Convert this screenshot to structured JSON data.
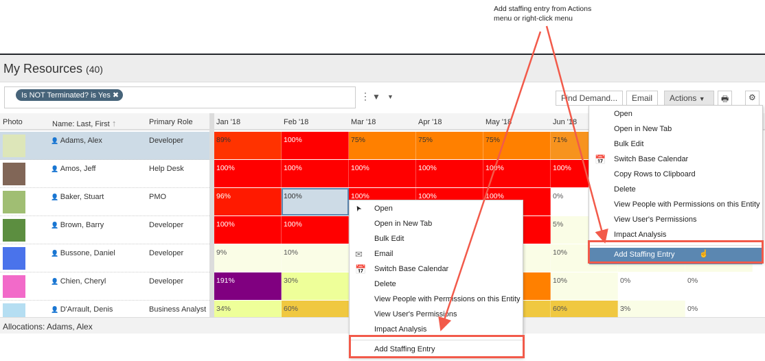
{
  "annotation": {
    "line1": "Add staffing entry from Actions",
    "line2": "menu or right-click menu"
  },
  "title": "My Resources",
  "count": "(40)",
  "filter": {
    "chip": "Is NOT Terminated? is Yes"
  },
  "toolbar": {
    "find_demand": "Find Demand...",
    "email": "Email",
    "actions": "Actions"
  },
  "columns": {
    "photo": "Photo",
    "name": "Name: Last, First",
    "role": "Primary Role",
    "months": [
      "Jan '18",
      "Feb '18",
      "Mar '18",
      "Apr '18",
      "May '18",
      "Jun '18"
    ]
  },
  "colors": {
    "red": "#ff0000",
    "orange": "#ff8000",
    "purple": "#800080",
    "selected": "#cddbe6",
    "accent": "#5b87b1",
    "highlight": "#f25a4a"
  },
  "rows": [
    {
      "name": "Adams, Alex",
      "role": "Developer",
      "avatar": "#dfe8b0",
      "selected": true,
      "cells": [
        [
          "89%",
          "#ff3300",
          "#333"
        ],
        [
          "100%",
          "#ff0000",
          "#fff"
        ],
        [
          "75%",
          "#ff8000",
          "#333"
        ],
        [
          "75%",
          "#ff8000",
          "#333"
        ],
        [
          "75%",
          "#ff8000",
          "#333"
        ],
        [
          "71%",
          "#f7931e",
          "#333"
        ],
        [
          "",
          "#f7931e",
          "#333"
        ],
        [
          "",
          "#f7931e",
          "#333"
        ]
      ]
    },
    {
      "name": "Amos, Jeff",
      "role": "Help Desk",
      "avatar": "#6b4b3a",
      "cells": [
        [
          "100%",
          "#ff0000",
          "#fff"
        ],
        [
          "100%",
          "#ff0000",
          "#fff"
        ],
        [
          "100%",
          "#ff0000",
          "#fff"
        ],
        [
          "100%",
          "#ff0000",
          "#fff"
        ],
        [
          "100%",
          "#ff0000",
          "#fff"
        ],
        [
          "100%",
          "#ff0000",
          "#fff"
        ],
        [
          "",
          "#ff0000",
          "#fff"
        ],
        [
          "",
          "#ff0000",
          "#fff"
        ]
      ]
    },
    {
      "name": "Baker, Stuart",
      "role": "PMO",
      "avatar": "#8fb35a",
      "cells": [
        [
          "96%",
          "#ff1a00",
          "#fff"
        ],
        [
          "100%",
          "#cddbe6",
          "#333"
        ],
        [
          "100%",
          "#ff0000",
          "#fff"
        ],
        [
          "100%",
          "#ff0000",
          "#fff"
        ],
        [
          "100%",
          "#ff0000",
          "#fff"
        ],
        [
          "0%",
          "#ffffff",
          "#555"
        ],
        [
          "",
          "#ffffff",
          "#555"
        ],
        [
          "",
          "#ffffff",
          "#555"
        ]
      ]
    },
    {
      "name": "Brown, Barry",
      "role": "Developer",
      "avatar": "#3f7a1e",
      "cells": [
        [
          "100%",
          "#ff0000",
          "#fff"
        ],
        [
          "100%",
          "#ff0000",
          "#fff"
        ],
        [
          "",
          "#ff0000",
          "#fff"
        ],
        [
          "",
          "#ff0000",
          "#fff"
        ],
        [
          "",
          "#ff0000",
          "#fff"
        ],
        [
          "5%",
          "#fafde6",
          "#555"
        ],
        [
          "",
          "#fafde6",
          "#555"
        ],
        [
          "",
          "#fafde6",
          "#555"
        ]
      ]
    },
    {
      "name": "Bussone, Daniel",
      "role": "Developer",
      "avatar": "#2a5ae8",
      "cells": [
        [
          "9%",
          "#fafde6",
          "#555"
        ],
        [
          "10%",
          "#fafde6",
          "#555"
        ],
        [
          "",
          "#fafde6",
          "#555"
        ],
        [
          "",
          "#fafde6",
          "#555"
        ],
        [
          "",
          "#fafde6",
          "#555"
        ],
        [
          "10%",
          "#fafde6",
          "#555"
        ],
        [
          "",
          "#fafde6",
          "#555"
        ],
        [
          "",
          "#fafde6",
          "#555"
        ]
      ]
    },
    {
      "name": "Chien, Cheryl",
      "role": "Developer",
      "avatar": "#f050c0",
      "cells": [
        [
          "191%",
          "#800080",
          "#fff"
        ],
        [
          "30%",
          "#eeff99",
          "#555"
        ],
        [
          "",
          "#eeff99",
          "#555"
        ],
        [
          "",
          "#eeff99",
          "#555"
        ],
        [
          "",
          "#ff8000",
          "#333"
        ],
        [
          "10%",
          "#fafde6",
          "#555"
        ],
        [
          "0%",
          "#ffffff",
          "#555"
        ],
        [
          "0%",
          "#ffffff",
          "#555"
        ]
      ]
    },
    {
      "name": "D'Arrault, Denis",
      "role": "Business Analyst",
      "avatar": "#a8d8f0",
      "cells": [
        [
          "34%",
          "#eeff99",
          "#555"
        ],
        [
          "60%",
          "#f0c840",
          "#555"
        ],
        [
          "",
          "#f0c840",
          "#555"
        ],
        [
          "",
          "#f0c840",
          "#555"
        ],
        [
          "",
          "#f0c840",
          "#555"
        ],
        [
          "60%",
          "#f0c840",
          "#555"
        ],
        [
          "3%",
          "#fafde6",
          "#555"
        ],
        [
          "0%",
          "#ffffff",
          "#555"
        ]
      ]
    }
  ],
  "bottom": {
    "label": "Allocations: Adams, Alex"
  },
  "actions_menu": [
    {
      "label": "Open"
    },
    {
      "label": "Open in New Tab"
    },
    {
      "label": "Bulk Edit"
    },
    {
      "label": "Switch Base Calendar",
      "icon": "calendar-icon"
    },
    {
      "label": "Copy Rows to Clipboard"
    },
    {
      "label": "Delete"
    },
    {
      "label": "View People with Permissions on this Entity"
    },
    {
      "label": "View User's Permissions"
    },
    {
      "label": "Impact Analysis"
    },
    {
      "label": "Add Staffing Entry",
      "active": true
    }
  ],
  "context_menu": [
    {
      "label": "Open",
      "icon": "cursor-icon"
    },
    {
      "label": "Open in New Tab"
    },
    {
      "label": "Bulk Edit"
    },
    {
      "label": "Email",
      "icon": "envelope-icon"
    },
    {
      "label": "Switch Base Calendar",
      "icon": "calendar-icon"
    },
    {
      "label": "Delete"
    },
    {
      "label": "View People with Permissions on this Entity"
    },
    {
      "label": "View User's Permissions"
    },
    {
      "label": "Impact Analysis"
    },
    {
      "label": "Add Staffing Entry"
    }
  ]
}
